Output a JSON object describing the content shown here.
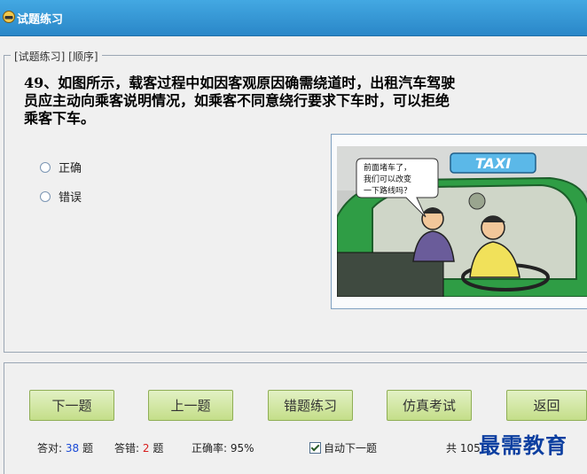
{
  "window": {
    "title": "试题练习"
  },
  "group": {
    "caption": "[试题练习] [顺序]"
  },
  "question": {
    "lines": [
      "49、如图所示，载客过程中如因客观原因确需绕道时，出租汽车驾驶",
      "员应主动向乘客说明情况，如乘客不同意绕行要求下车时，可以拒绝",
      "乘客下车。"
    ]
  },
  "options": [
    {
      "label": "正确",
      "selected": false
    },
    {
      "label": "错误",
      "selected": false
    }
  ],
  "illustration": {
    "taxi_sign": "TAXI",
    "speech": [
      "前面堵车了，",
      "我们可以改变",
      "一下路线吗？"
    ]
  },
  "buttons": {
    "next": "下一题",
    "prev": "上一题",
    "wrong_practice": "错题练习",
    "mock_exam": "仿真考试",
    "back": "返回"
  },
  "stats": {
    "correct_label": "答对:",
    "correct_count": "38",
    "wrong_label": "答错:",
    "wrong_count": "2",
    "unit": "题",
    "rate_label": "正确率:",
    "rate_value": "95%",
    "auto_next_label": "自动下一题",
    "auto_next_checked": true,
    "total_prefix": "共",
    "total_value": "105"
  },
  "watermark": "最需教育",
  "colors": {
    "titlebar": "#2a87c8",
    "button_green": "#c4de89",
    "correct_num": "#1a4ad6",
    "wrong_num": "#d81e1e"
  }
}
